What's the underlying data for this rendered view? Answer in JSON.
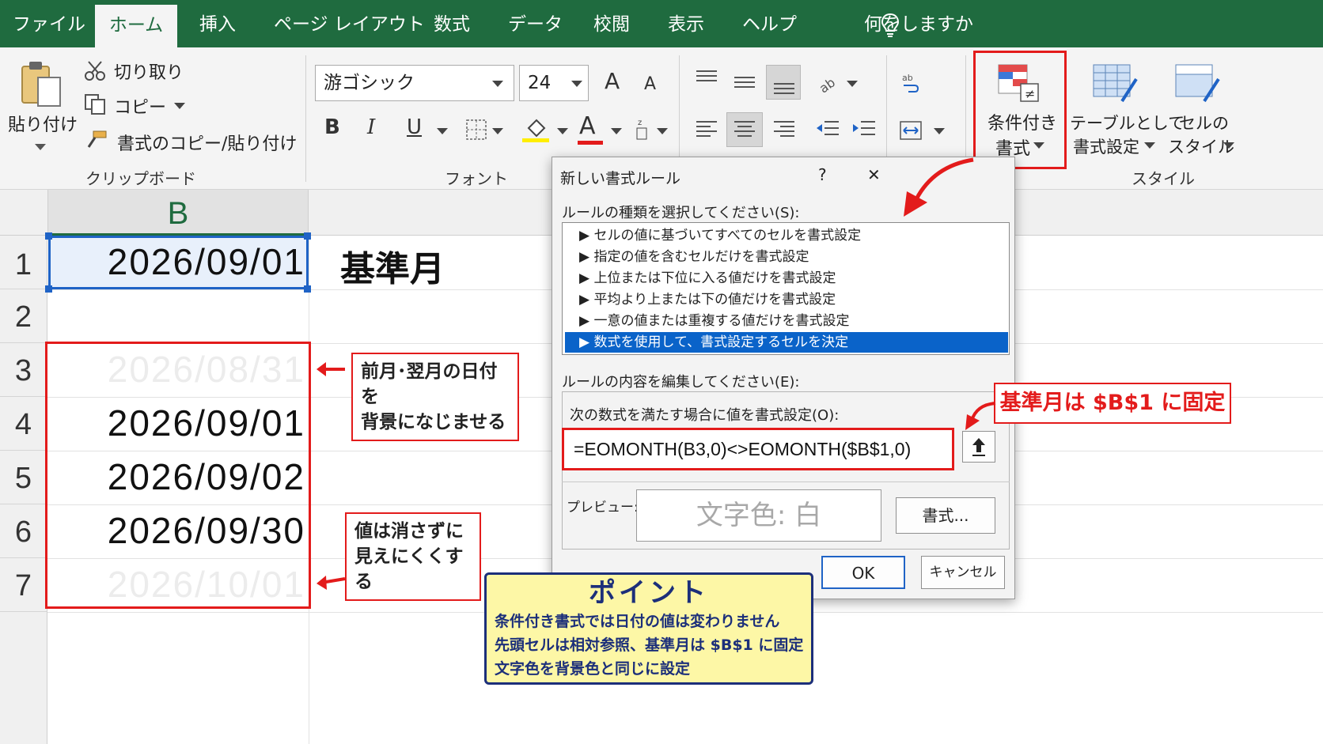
{
  "tabs": [
    "ファイル",
    "ホーム",
    "挿入",
    "ページ レイアウト",
    "数式",
    "データ",
    "校閲",
    "表示",
    "ヘルプ"
  ],
  "tell_me": "何をしますか",
  "clipboard": {
    "paste": "貼り付け",
    "cut": "切り取り",
    "copy": "コピー",
    "format_painter": "書式のコピー/貼り付け",
    "label": "クリップボード"
  },
  "font": {
    "name": "游ゴシック",
    "size": "24",
    "bold": "B",
    "italic": "I",
    "underline": "U",
    "grow": "A",
    "shrink": "A",
    "font_color": "A",
    "label": "フォント"
  },
  "styles": {
    "conditional_format_l1": "条件付き",
    "conditional_format_l2": "書式",
    "table_format_l1": "テーブルとして",
    "table_format_l2": "書式設定",
    "cell_style_l1": "セルの",
    "cell_style_l2": "スタイル",
    "label": "スタイル"
  },
  "sheet": {
    "column": "B",
    "rows": [
      "1",
      "2",
      "3",
      "4",
      "5",
      "6",
      "7"
    ],
    "b1": "2026/09/01",
    "c1": "基準月",
    "b3": "2026/08/31",
    "b4": "2026/09/01",
    "b5": "2026/09/02",
    "b6": "2026/09/30",
    "b7": "2026/10/01"
  },
  "dialog": {
    "title": "新しい書式ルール",
    "help": "?",
    "close": "✕",
    "rule_type_label": "ルールの種類を選択してください(S):",
    "rule_types": [
      "▶ セルの値に基づいてすべてのセルを書式設定",
      "▶ 指定の値を含むセルだけを書式設定",
      "▶ 上位または下位に入る値だけを書式設定",
      "▶ 平均より上または下の値だけを書式設定",
      "▶ 一意の値または重複する値だけを書式設定",
      "▶ 数式を使用して、書式設定するセルを決定"
    ],
    "edit_label": "ルールの内容を編集してください(E):",
    "formula_label": "次の数式を満たす場合に値を書式設定(O):",
    "formula": "=EOMONTH(B3,0)<>EOMONTH($B$1,0)",
    "preview_label": "プレビュー:",
    "preview_text": "文字色: 白",
    "format_button": "書式...",
    "ok": "OK",
    "cancel": "キャンセル"
  },
  "annotations": {
    "callout1_l1": "前月･翌月の日付を",
    "callout1_l2": "背景になじませる",
    "callout2_l1": "値は消さずに",
    "callout2_l2": "見えにくくする",
    "callout3": "基準月は $B$1 に固定",
    "point_title": "ポイント",
    "point_lines": [
      "条件付き書式では日付の値は変わりません",
      "先頭セルは相対参照、基準月は $B$1 に固定",
      "文字色を背景色と同じに設定"
    ]
  },
  "colors": {
    "ribbon_green": "#1f6b3f",
    "annotation_red": "#e31b1b",
    "selection_blue": "#0a63c9",
    "point_bg": "#fdf7a6",
    "point_border": "#1c2f7a"
  }
}
